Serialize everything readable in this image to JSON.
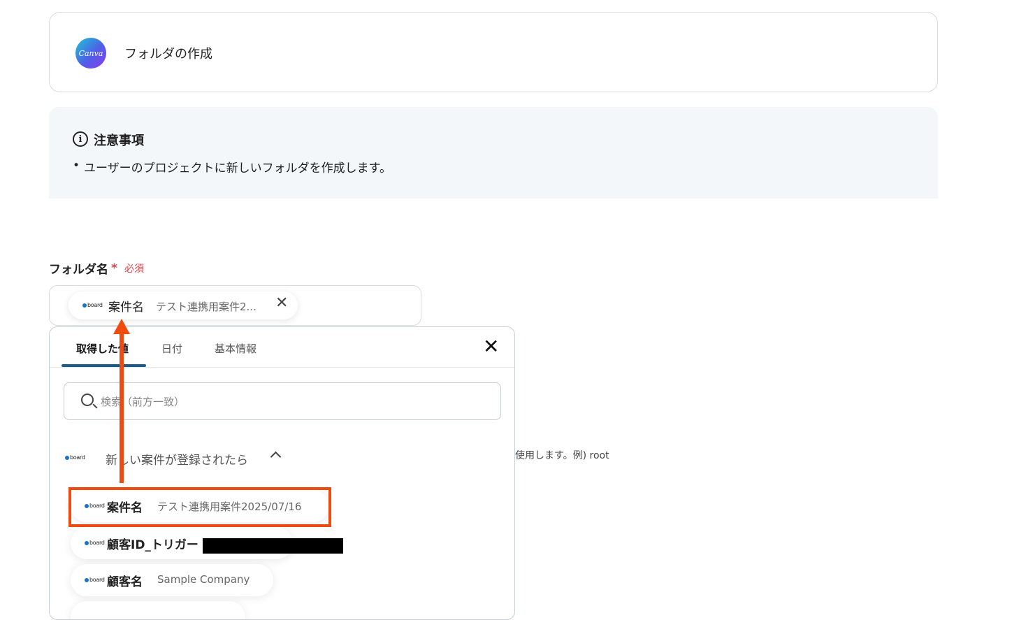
{
  "action": {
    "app_logo_text": "Canva",
    "title": "フォルダの作成"
  },
  "notice": {
    "icon": "info-icon",
    "title": "注意事項",
    "bullet": "•",
    "items": [
      "ユーザーのプロジェクトに新しいフォルダを作成します。"
    ]
  },
  "field": {
    "label": "フォルダ名",
    "required_mark": "*",
    "required_text": "必須",
    "chip": {
      "logo_text": "board",
      "name": "案件名",
      "value": "テスト連携用案件2...",
      "remove": "✕"
    },
    "hint_fragment": "使用します。例) root"
  },
  "picker": {
    "tabs": [
      {
        "label": "取得した値",
        "active": true
      },
      {
        "label": "日付",
        "active": false
      },
      {
        "label": "基本情報",
        "active": false
      }
    ],
    "close": "✕",
    "search_placeholder": "検索（前方一致）",
    "group": {
      "logo_text": "board",
      "title": "新しい案件が登録されたら"
    },
    "options": [
      {
        "logo_text": "board",
        "name": "案件名",
        "value": "テスト連携用案件2025/07/16"
      },
      {
        "logo_text": "board",
        "name": "顧客ID_トリガー",
        "value": ""
      },
      {
        "logo_text": "board",
        "name": "顧客名",
        "value": "Sample Company"
      }
    ]
  },
  "colors": {
    "accent": "#1c5d8b",
    "required": "#e5484d",
    "annotation": "#f04b0e"
  }
}
